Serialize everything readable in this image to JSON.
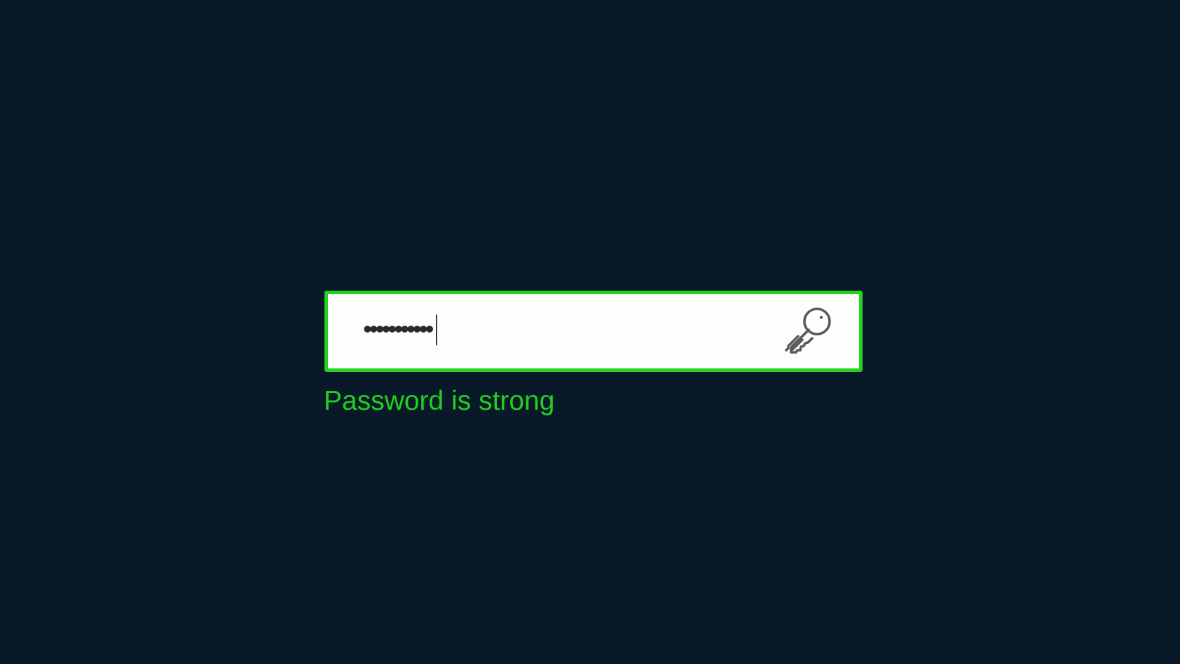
{
  "password_field": {
    "masked_value": "•••••••••••",
    "border_color": "#22d41e",
    "background_color": "#fdfdfc"
  },
  "status": {
    "message": "Password is strong",
    "color": "#1fd11d"
  },
  "icons": {
    "reveal_toggle": "key-icon"
  },
  "theme": {
    "page_background": "#0a1929"
  }
}
